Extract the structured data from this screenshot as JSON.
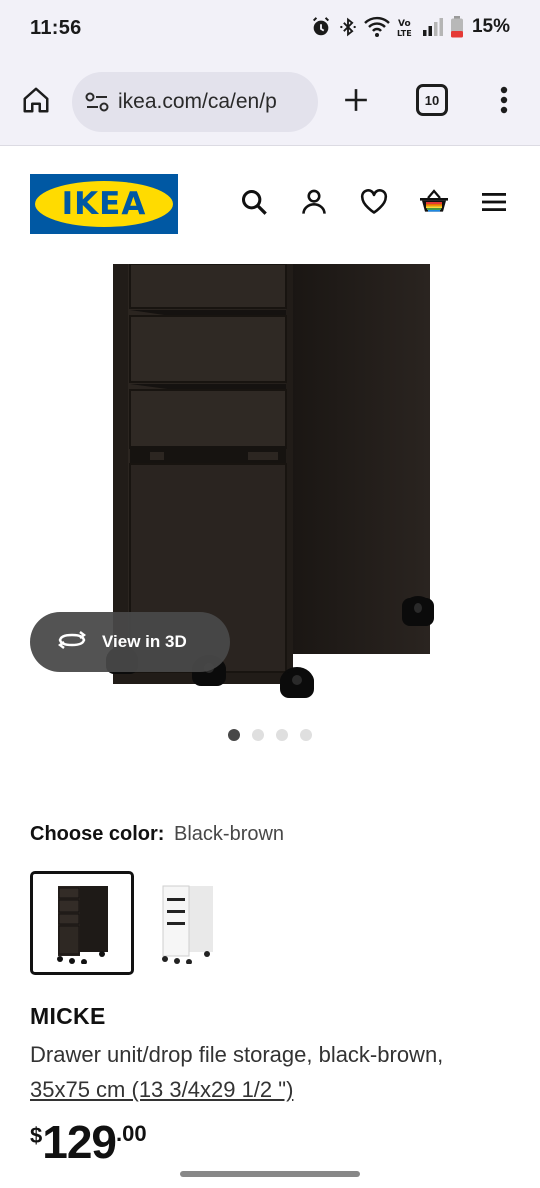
{
  "status_bar": {
    "time": "11:56",
    "battery": "15%",
    "icons": [
      "alarm-icon",
      "bluetooth-icon",
      "wifi-icon",
      "volte-icon",
      "signal-icon",
      "battery-icon"
    ]
  },
  "browser": {
    "url": "ikea.com/ca/en/p",
    "tab_count": "10",
    "icons": [
      "home-icon",
      "site-settings-icon",
      "new-tab-icon",
      "tabs-icon",
      "more-vert-icon"
    ]
  },
  "header": {
    "logo_text": "IKEA",
    "icons": [
      "search-icon",
      "account-icon",
      "favorites-icon",
      "cart-icon",
      "hamburger-menu-icon"
    ],
    "colors": {
      "logo_blue": "#0058a3",
      "logo_yellow": "#ffdb00"
    }
  },
  "gallery": {
    "view3d_label": "View in 3D",
    "image_count": 4,
    "active_index": 0
  },
  "color_picker": {
    "label": "Choose color:",
    "selected": "Black-brown",
    "options": [
      {
        "name": "Black-brown",
        "selected": true
      },
      {
        "name": "White",
        "selected": false
      }
    ]
  },
  "product": {
    "name": "MICKE",
    "description": "Drawer unit/drop file storage, black-brown,",
    "dimensions": "35x75 cm (13 3/4x29 1/2 \")",
    "price_currency": "$",
    "price_whole": "129",
    "price_cents": ".00"
  }
}
